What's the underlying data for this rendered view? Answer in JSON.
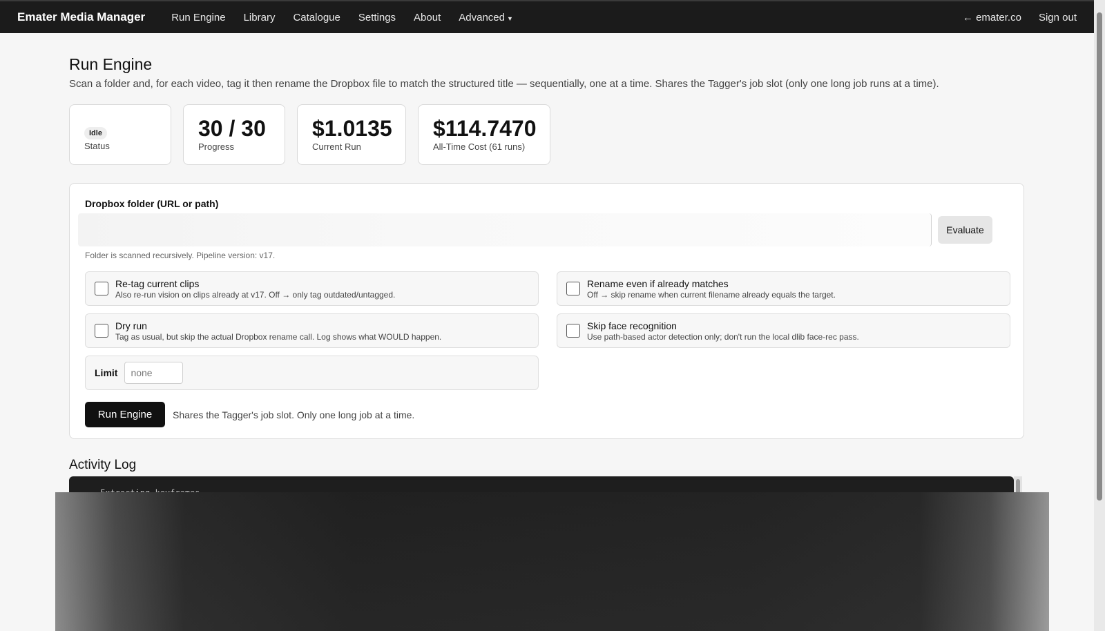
{
  "nav": {
    "brand": "Emater Media Manager",
    "links": [
      "Run Engine",
      "Library",
      "Catalogue",
      "Settings",
      "About"
    ],
    "advanced": "Advanced",
    "right": [
      "← emater.co",
      "Sign out"
    ]
  },
  "page": {
    "title": "Run Engine",
    "description": "Scan a folder and, for each video, tag it then rename the Dropbox file to match the structured title — sequentially, one at a time. Shares the Tagger's job slot (only one long job runs at a time)."
  },
  "stats": {
    "status": {
      "badge": "Idle",
      "label": "Status"
    },
    "progress": {
      "value": "30 / 30",
      "label": "Progress"
    },
    "current_run": {
      "value": "$1.0135",
      "label": "Current Run"
    },
    "all_time": {
      "value": "$114.7470",
      "label": "All-Time Cost (61 runs)"
    }
  },
  "form": {
    "folder_label": "Dropbox folder (URL or path)",
    "folder_value": "",
    "evaluate_label": "Evaluate",
    "hint": "Folder is scanned recursively. Pipeline version: v17.",
    "options": [
      {
        "title": "Re-tag current clips",
        "desc": "Also re-run vision on clips already at v17. Off → only tag outdated/untagged.",
        "checked": false
      },
      {
        "title": "Rename even if already matches",
        "desc": "Off → skip rename when current filename already equals the target.",
        "checked": false
      },
      {
        "title": "Dry run",
        "desc": "Tag as usual, but skip the actual Dropbox rename call. Log shows what WOULD happen.",
        "checked": false
      },
      {
        "title": "Skip face recognition",
        "desc": "Use path-based actor detection only; don't run the local dlib face-rec pass.",
        "checked": false
      }
    ],
    "limit_label": "Limit",
    "limit_placeholder": "none",
    "run_label": "Run Engine",
    "run_note": "Shares the Tagger's job slot. Only one long job at a time."
  },
  "log": {
    "title": "Activity Log",
    "first_line": "Extracting keyframes..."
  }
}
